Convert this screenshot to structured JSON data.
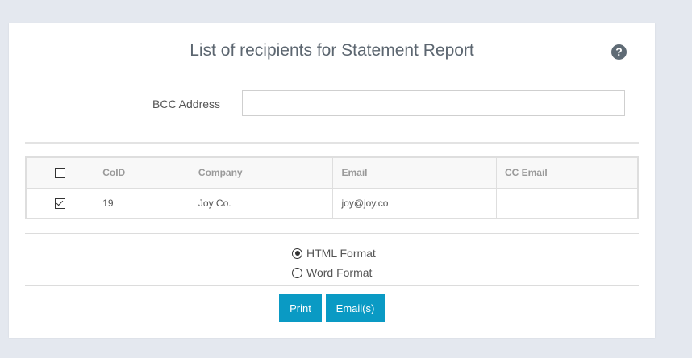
{
  "dialog": {
    "title": "List of recipients for Statement Report",
    "help_icon": "question-circle-icon",
    "help_glyph": "?"
  },
  "bcc": {
    "label": "BCC Address",
    "value": "",
    "placeholder": ""
  },
  "table": {
    "columns": [
      "CoID",
      "Company",
      "Email",
      "CC Email"
    ],
    "rows": [
      {
        "checked": true,
        "coid": "19",
        "company": "Joy Co.",
        "email": "joy@joy.co",
        "cc_email": ""
      }
    ]
  },
  "format": {
    "options": [
      {
        "label": "HTML Format",
        "selected": true
      },
      {
        "label": "Word Format",
        "selected": false
      }
    ]
  },
  "actions": {
    "print_label": "Print",
    "email_label": "Email(s)"
  },
  "colors": {
    "accent": "#0a9ac4",
    "background": "#e4e8ef"
  }
}
